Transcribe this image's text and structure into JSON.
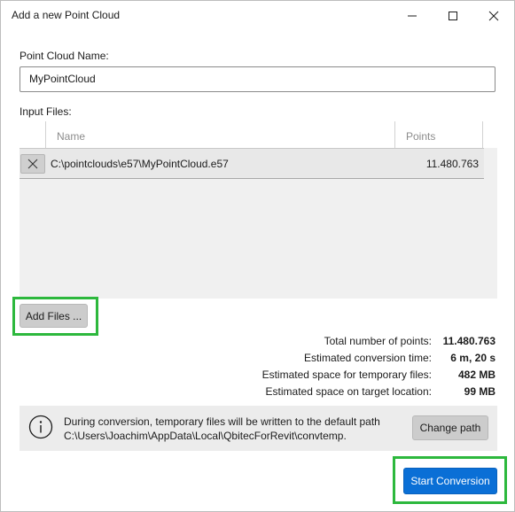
{
  "window": {
    "title": "Add a new Point Cloud"
  },
  "form": {
    "name_label": "Point Cloud Name:",
    "name_value": "MyPointCloud",
    "input_files_label": "Input Files:"
  },
  "files_table": {
    "columns": [
      "Name",
      "Points"
    ],
    "rows": [
      {
        "name": "C:\\pointclouds\\e57\\MyPointCloud.e57",
        "points": "11.480.763"
      }
    ]
  },
  "buttons": {
    "add_files": "Add Files ...",
    "change_path": "Change path",
    "start_conversion": "Start Conversion"
  },
  "stats": [
    {
      "label": "Total number of points:",
      "value": "11.480.763"
    },
    {
      "label": "Estimated conversion time:",
      "value": "6 m, 20 s"
    },
    {
      "label": "Estimated space for temporary files:",
      "value": "482 MB"
    },
    {
      "label": "Estimated space on target location:",
      "value": "99 MB"
    }
  ],
  "info": {
    "line1": "During conversion, temporary files will be written to the default path",
    "line2": "C:\\Users\\Joachim\\AppData\\Local\\QbitecForRevit\\convtemp."
  },
  "colors": {
    "accent": "#0a6fd6",
    "highlight": "#2db83d"
  },
  "icons": [
    "minimize-icon",
    "maximize-icon",
    "close-icon",
    "remove-file-icon",
    "info-icon"
  ]
}
